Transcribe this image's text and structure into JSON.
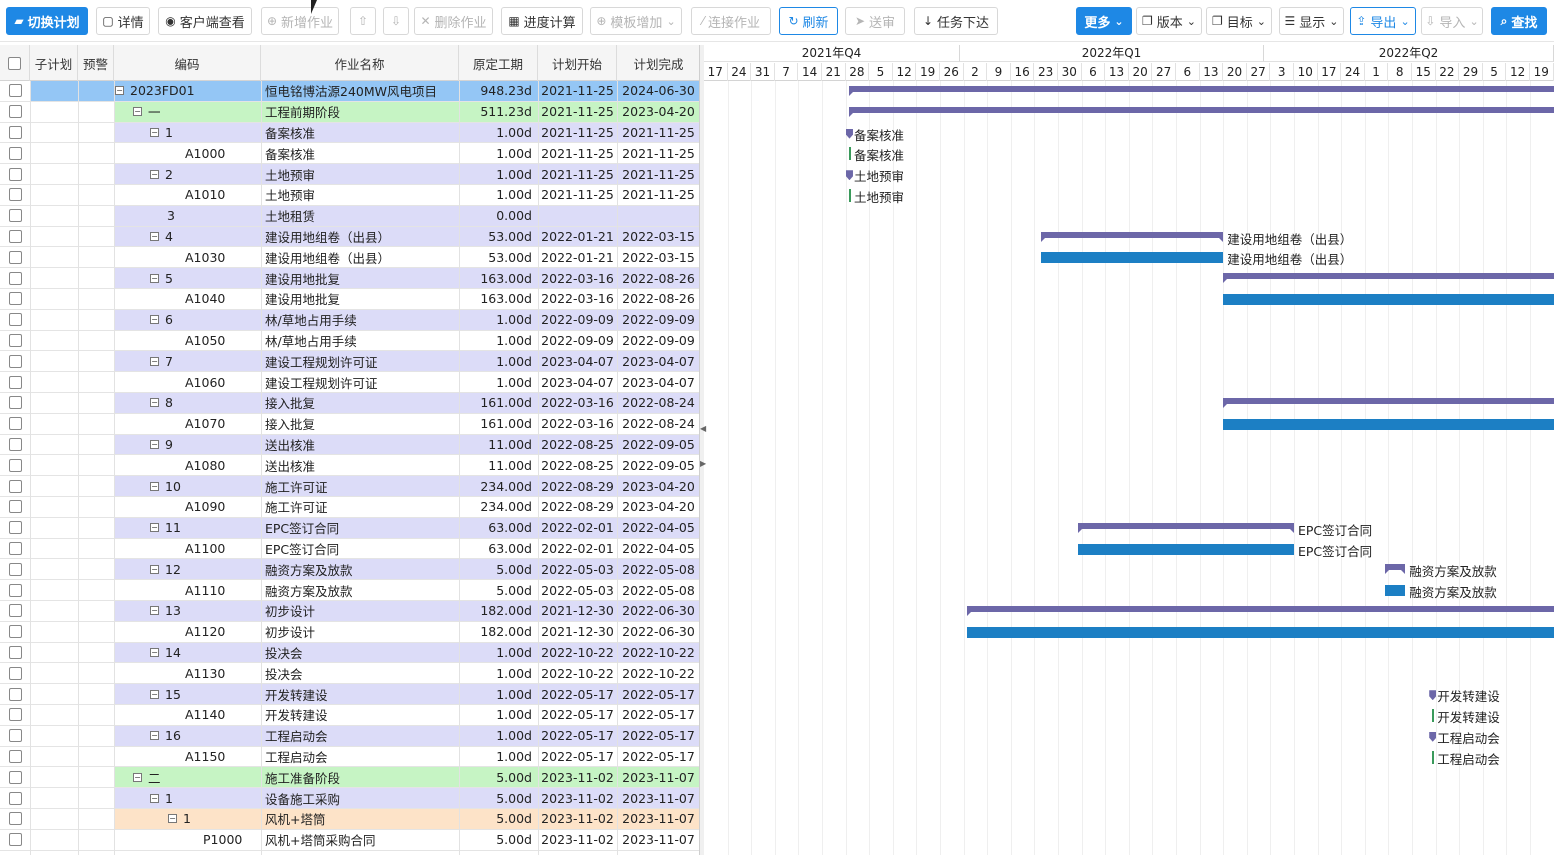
{
  "toolbar": {
    "buttons": [
      {
        "label": "切换计划",
        "icon": "folder-open-icon",
        "glyph": "▰",
        "style": "primary"
      },
      {
        "label": "详情",
        "icon": "document-icon",
        "glyph": "▢",
        "style": "normal"
      },
      {
        "label": "客户端查看",
        "icon": "eye-icon",
        "glyph": "◉",
        "style": "normal"
      },
      {
        "label": "新增作业",
        "icon": "plus-circle-icon",
        "glyph": "⊕",
        "style": "disabled"
      },
      {
        "label": "",
        "icon": "arrow-up-circle-icon",
        "glyph": "⇧",
        "style": "disabled"
      },
      {
        "label": "",
        "icon": "arrow-down-circle-icon",
        "glyph": "⇩",
        "style": "disabled"
      },
      {
        "label": "删除作业",
        "icon": "trash-icon",
        "glyph": "✕",
        "style": "disabled"
      },
      {
        "label": "进度计算",
        "icon": "calendar-icon",
        "glyph": "▦",
        "style": "normal"
      },
      {
        "label": "模板增加",
        "icon": "plus-circle-icon",
        "glyph": "⊕",
        "style": "disabled",
        "caret": true
      },
      {
        "label": "连接作业",
        "icon": "link-icon",
        "glyph": "⁄",
        "style": "disabled"
      },
      {
        "label": "刷新",
        "icon": "refresh-icon",
        "glyph": "↻",
        "style": "blue-outline"
      },
      {
        "label": "送审",
        "icon": "send-icon",
        "glyph": "➤",
        "style": "disabled"
      },
      {
        "label": "任务下达",
        "icon": "arrow-down-icon",
        "glyph": "↓",
        "style": "normal"
      },
      {
        "label": "更多",
        "icon": "",
        "glyph": "",
        "style": "primary",
        "caret": true
      },
      {
        "label": "版本",
        "icon": "copy-icon",
        "glyph": "❐",
        "style": "normal",
        "caret": true
      },
      {
        "label": "目标",
        "icon": "copy-icon",
        "glyph": "❐",
        "style": "normal",
        "caret": true
      },
      {
        "label": "显示",
        "icon": "list-icon",
        "glyph": "☰",
        "style": "normal",
        "caret": true
      },
      {
        "label": "导出",
        "icon": "upload-icon",
        "glyph": "⇪",
        "style": "blue-outline",
        "caret": true
      },
      {
        "label": "导入",
        "icon": "download-icon",
        "glyph": "⇩",
        "style": "disabled",
        "caret": true
      },
      {
        "label": "查找",
        "icon": "search-icon",
        "glyph": "⌕",
        "style": "primary"
      }
    ]
  },
  "grid": {
    "columns": [
      "子计划",
      "预警",
      "编码",
      "作业名称",
      "原定工期",
      "计划开始",
      "计划完成"
    ],
    "rows": [
      {
        "code": "2023FD01",
        "name": "恒电铭博沽源240MW风电项目",
        "dur": "948.23d",
        "start": "2021-11-25",
        "end": "2024-06-30",
        "level": 0,
        "toggle": true,
        "kind": "project"
      },
      {
        "code": "一",
        "name": "工程前期阶段",
        "dur": "511.23d",
        "start": "2021-11-25",
        "end": "2023-04-20",
        "level": 1,
        "toggle": true,
        "kind": "phase"
      },
      {
        "code": "1",
        "name": "备案核准",
        "dur": "1.00d",
        "start": "2021-11-25",
        "end": "2021-11-25",
        "level": 2,
        "toggle": true,
        "kind": "wbs"
      },
      {
        "code": "A1000",
        "name": "备案核准",
        "dur": "1.00d",
        "start": "2021-11-25",
        "end": "2021-11-25",
        "level": 3,
        "toggle": false,
        "kind": "task"
      },
      {
        "code": "2",
        "name": "土地预审",
        "dur": "1.00d",
        "start": "2021-11-25",
        "end": "2021-11-25",
        "level": 2,
        "toggle": true,
        "kind": "wbs"
      },
      {
        "code": "A1010",
        "name": "土地预审",
        "dur": "1.00d",
        "start": "2021-11-25",
        "end": "2021-11-25",
        "level": 3,
        "toggle": false,
        "kind": "task"
      },
      {
        "code": "3",
        "name": "土地租赁",
        "dur": "0.00d",
        "start": "",
        "end": "",
        "level": 2,
        "toggle": false,
        "kind": "wbs"
      },
      {
        "code": "4",
        "name": "建设用地组卷（出县）",
        "dur": "53.00d",
        "start": "2022-01-21",
        "end": "2022-03-15",
        "level": 2,
        "toggle": true,
        "kind": "wbs"
      },
      {
        "code": "A1030",
        "name": "建设用地组卷（出县）",
        "dur": "53.00d",
        "start": "2022-01-21",
        "end": "2022-03-15",
        "level": 3,
        "toggle": false,
        "kind": "task"
      },
      {
        "code": "5",
        "name": "建设用地批复",
        "dur": "163.00d",
        "start": "2022-03-16",
        "end": "2022-08-26",
        "level": 2,
        "toggle": true,
        "kind": "wbs"
      },
      {
        "code": "A1040",
        "name": "建设用地批复",
        "dur": "163.00d",
        "start": "2022-03-16",
        "end": "2022-08-26",
        "level": 3,
        "toggle": false,
        "kind": "task"
      },
      {
        "code": "6",
        "name": "林/草地占用手续",
        "dur": "1.00d",
        "start": "2022-09-09",
        "end": "2022-09-09",
        "level": 2,
        "toggle": true,
        "kind": "wbs"
      },
      {
        "code": "A1050",
        "name": "林/草地占用手续",
        "dur": "1.00d",
        "start": "2022-09-09",
        "end": "2022-09-09",
        "level": 3,
        "toggle": false,
        "kind": "task"
      },
      {
        "code": "7",
        "name": "建设工程规划许可证",
        "dur": "1.00d",
        "start": "2023-04-07",
        "end": "2023-04-07",
        "level": 2,
        "toggle": true,
        "kind": "wbs"
      },
      {
        "code": "A1060",
        "name": "建设工程规划许可证",
        "dur": "1.00d",
        "start": "2023-04-07",
        "end": "2023-04-07",
        "level": 3,
        "toggle": false,
        "kind": "task"
      },
      {
        "code": "8",
        "name": "接入批复",
        "dur": "161.00d",
        "start": "2022-03-16",
        "end": "2022-08-24",
        "level": 2,
        "toggle": true,
        "kind": "wbs"
      },
      {
        "code": "A1070",
        "name": "接入批复",
        "dur": "161.00d",
        "start": "2022-03-16",
        "end": "2022-08-24",
        "level": 3,
        "toggle": false,
        "kind": "task"
      },
      {
        "code": "9",
        "name": "送出核准",
        "dur": "11.00d",
        "start": "2022-08-25",
        "end": "2022-09-05",
        "level": 2,
        "toggle": true,
        "kind": "wbs"
      },
      {
        "code": "A1080",
        "name": "送出核准",
        "dur": "11.00d",
        "start": "2022-08-25",
        "end": "2022-09-05",
        "level": 3,
        "toggle": false,
        "kind": "task"
      },
      {
        "code": "10",
        "name": "施工许可证",
        "dur": "234.00d",
        "start": "2022-08-29",
        "end": "2023-04-20",
        "level": 2,
        "toggle": true,
        "kind": "wbs"
      },
      {
        "code": "A1090",
        "name": "施工许可证",
        "dur": "234.00d",
        "start": "2022-08-29",
        "end": "2023-04-20",
        "level": 3,
        "toggle": false,
        "kind": "task"
      },
      {
        "code": "11",
        "name": "EPC签订合同",
        "dur": "63.00d",
        "start": "2022-02-01",
        "end": "2022-04-05",
        "level": 2,
        "toggle": true,
        "kind": "wbs"
      },
      {
        "code": "A1100",
        "name": "EPC签订合同",
        "dur": "63.00d",
        "start": "2022-02-01",
        "end": "2022-04-05",
        "level": 3,
        "toggle": false,
        "kind": "task"
      },
      {
        "code": "12",
        "name": "融资方案及放款",
        "dur": "5.00d",
        "start": "2022-05-03",
        "end": "2022-05-08",
        "level": 2,
        "toggle": true,
        "kind": "wbs"
      },
      {
        "code": "A1110",
        "name": "融资方案及放款",
        "dur": "5.00d",
        "start": "2022-05-03",
        "end": "2022-05-08",
        "level": 3,
        "toggle": false,
        "kind": "task"
      },
      {
        "code": "13",
        "name": "初步设计",
        "dur": "182.00d",
        "start": "2021-12-30",
        "end": "2022-06-30",
        "level": 2,
        "toggle": true,
        "kind": "wbs"
      },
      {
        "code": "A1120",
        "name": "初步设计",
        "dur": "182.00d",
        "start": "2021-12-30",
        "end": "2022-06-30",
        "level": 3,
        "toggle": false,
        "kind": "task"
      },
      {
        "code": "14",
        "name": "投决会",
        "dur": "1.00d",
        "start": "2022-10-22",
        "end": "2022-10-22",
        "level": 2,
        "toggle": true,
        "kind": "wbs"
      },
      {
        "code": "A1130",
        "name": "投决会",
        "dur": "1.00d",
        "start": "2022-10-22",
        "end": "2022-10-22",
        "level": 3,
        "toggle": false,
        "kind": "task"
      },
      {
        "code": "15",
        "name": "开发转建设",
        "dur": "1.00d",
        "start": "2022-05-17",
        "end": "2022-05-17",
        "level": 2,
        "toggle": true,
        "kind": "wbs"
      },
      {
        "code": "A1140",
        "name": "开发转建设",
        "dur": "1.00d",
        "start": "2022-05-17",
        "end": "2022-05-17",
        "level": 3,
        "toggle": false,
        "kind": "task"
      },
      {
        "code": "16",
        "name": "工程启动会",
        "dur": "1.00d",
        "start": "2022-05-17",
        "end": "2022-05-17",
        "level": 2,
        "toggle": true,
        "kind": "wbs"
      },
      {
        "code": "A1150",
        "name": "工程启动会",
        "dur": "1.00d",
        "start": "2022-05-17",
        "end": "2022-05-17",
        "level": 3,
        "toggle": false,
        "kind": "task"
      },
      {
        "code": "二",
        "name": "施工准备阶段",
        "dur": "5.00d",
        "start": "2023-11-02",
        "end": "2023-11-07",
        "level": 1,
        "toggle": true,
        "kind": "phase"
      },
      {
        "code": "1",
        "name": "设备施工采购",
        "dur": "5.00d",
        "start": "2023-11-02",
        "end": "2023-11-07",
        "level": 2,
        "toggle": true,
        "kind": "wbs"
      },
      {
        "code": "1",
        "name": "风机+塔筒",
        "dur": "5.00d",
        "start": "2023-11-02",
        "end": "2023-11-07",
        "level": 3,
        "toggle": true,
        "kind": "sub"
      },
      {
        "code": "P1000",
        "name": "风机+塔筒采购合同",
        "dur": "5.00d",
        "start": "2023-11-02",
        "end": "2023-11-07",
        "level": 4,
        "toggle": false,
        "kind": "task"
      }
    ]
  },
  "gantt": {
    "quarters": [
      "2021年Q4",
      "2022年Q1",
      "2022年Q2"
    ],
    "days": [
      "17",
      "24",
      "31",
      "7",
      "14",
      "21",
      "28",
      "5",
      "12",
      "19",
      "26",
      "2",
      "9",
      "16",
      "23",
      "30",
      "6",
      "13",
      "20",
      "27",
      "6",
      "13",
      "20",
      "27",
      "3",
      "10",
      "17",
      "24",
      "1",
      "8",
      "15",
      "22",
      "29",
      "5",
      "12",
      "19"
    ],
    "colors": {
      "summary": "#6c67a8",
      "task": "#1c7fc4",
      "milestone_task": "#3a9a5b",
      "project_row": "#94c6f5",
      "phase_row": "#c6f4c4",
      "wbs_row": "#dcdcf8",
      "sub_row": "#fde3c8"
    }
  }
}
